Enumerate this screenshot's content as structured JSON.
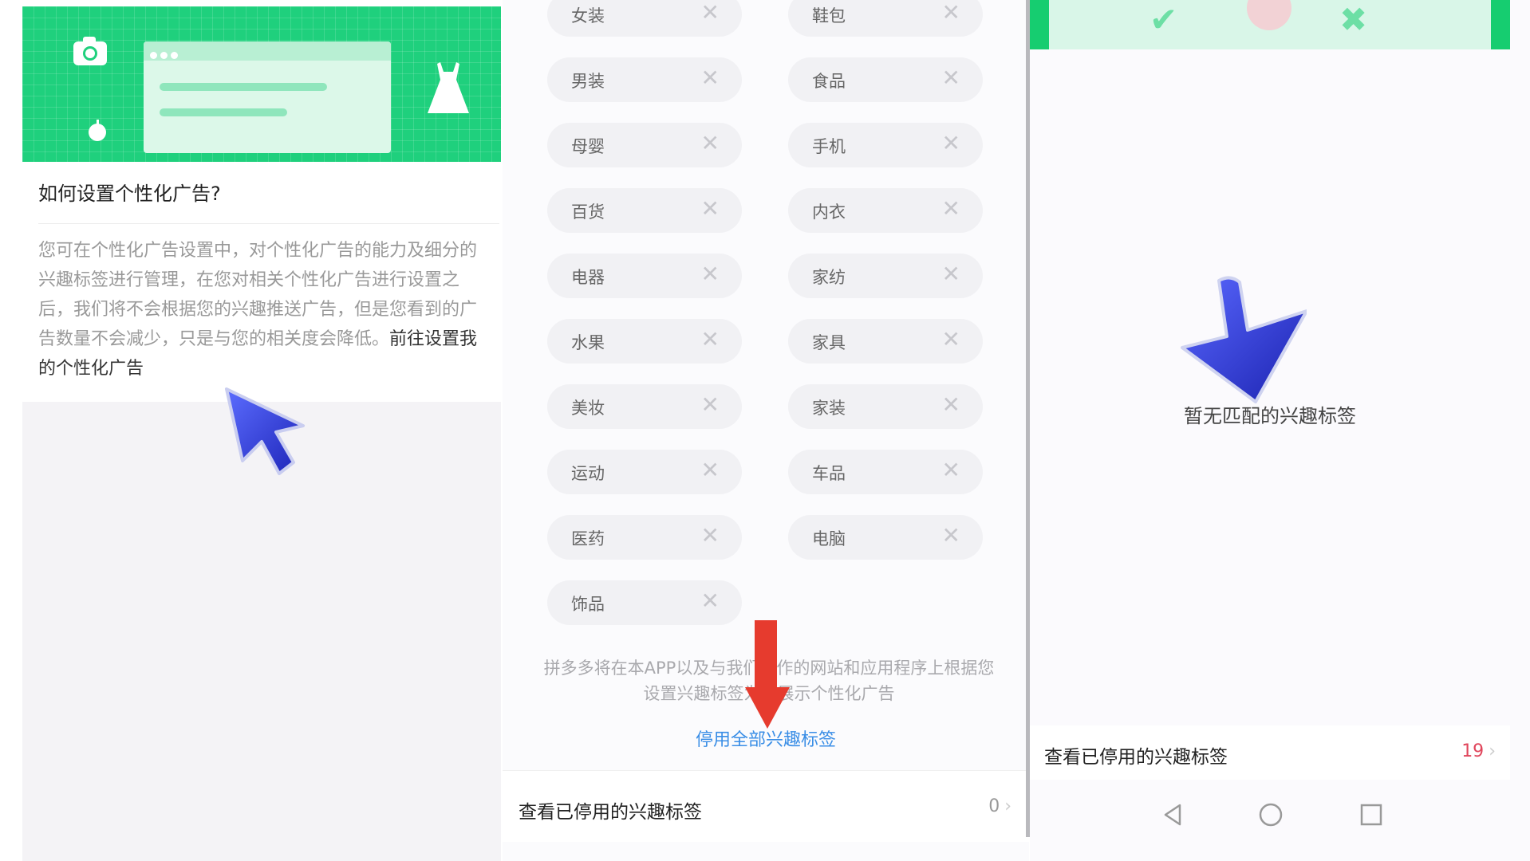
{
  "left": {
    "question_title": "如何设置个性化广告?",
    "description": "您可在个性化广告设置中，对个性化广告的能力及细分的兴趣标签进行管理，在您对相关个性化广告进行设置之后，我们将不会根据您的兴趣推送广告，但是您看到的广告数量不会减少，只是与您的相关度会降低。",
    "settings_link": "前往设置我的个性化广告"
  },
  "middle": {
    "tags_col1": [
      "女装",
      "男装",
      "母婴",
      "百货",
      "电器",
      "水果",
      "美妆",
      "运动",
      "医药",
      "饰品"
    ],
    "tags_col2": [
      "鞋包",
      "食品",
      "手机",
      "内衣",
      "家纺",
      "家具",
      "家装",
      "车品",
      "电脑"
    ],
    "note_line1": "拼多多将在本APP以及与我们合作的网站和应用程序上根据您",
    "note_line2": "设置兴趣标签为您展示个性化广告",
    "disable_all": "停用全部兴趣标签",
    "view_disabled": "查看已停用的兴趣标签",
    "disabled_count": "0",
    "chevron": "›"
  },
  "right": {
    "empty_text": "暂无匹配的兴趣标签",
    "view_disabled": "查看已停用的兴趣标签",
    "disabled_count": "19",
    "chevron": "›"
  },
  "colors": {
    "accent_green": "#1fd07d",
    "link_blue": "#3a8ee6",
    "count_red": "#e0455b",
    "overlay_blue": "#2f3be0",
    "overlay_red": "#e63b2e"
  },
  "icons": [
    "camera-icon",
    "dress-icon",
    "apple-icon",
    "close-icon",
    "back-icon",
    "home-icon",
    "recents-icon",
    "check-icon",
    "cross-icon"
  ]
}
